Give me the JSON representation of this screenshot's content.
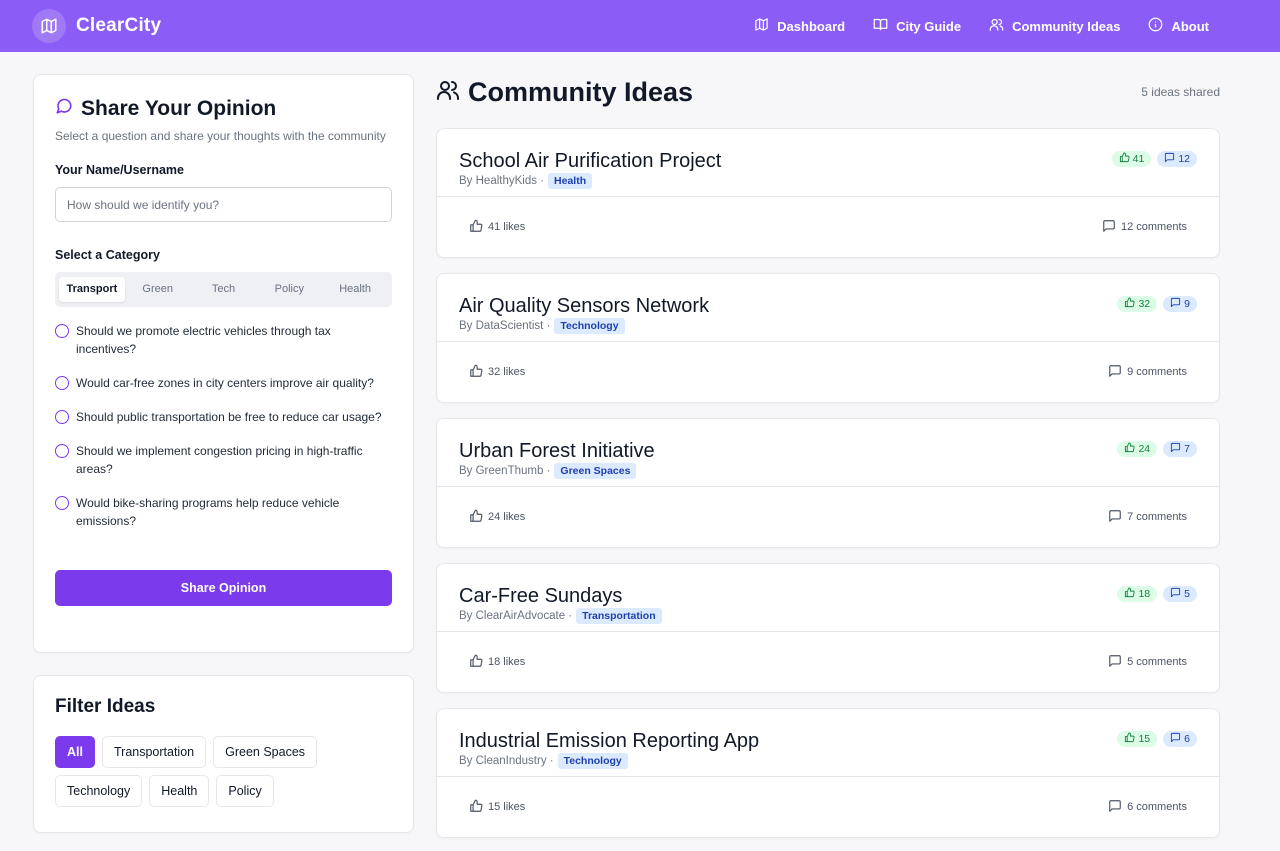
{
  "app": {
    "name": "ClearCity"
  },
  "nav": [
    {
      "label": "Dashboard",
      "icon": "map-icon"
    },
    {
      "label": "City Guide",
      "icon": "book-icon"
    },
    {
      "label": "Community Ideas",
      "icon": "users-icon"
    },
    {
      "label": "About",
      "icon": "info-icon"
    }
  ],
  "opinion": {
    "title": "Share Your Opinion",
    "subtitle": "Select a question and share your thoughts with the community",
    "name_label": "Your Name/Username",
    "name_placeholder": "How should we identify you?",
    "name_value": "",
    "category_label": "Select a Category",
    "tabs": [
      "Transport",
      "Green",
      "Tech",
      "Policy",
      "Health"
    ],
    "active_tab": "Transport",
    "questions": [
      "Should we promote electric vehicles through tax incentives?",
      "Would car-free zones in city centers improve air quality?",
      "Should public transportation be free to reduce car usage?",
      "Should we implement congestion pricing in high-traffic areas?",
      "Would bike-sharing programs help reduce vehicle emissions?"
    ],
    "submit_label": "Share Opinion"
  },
  "filter": {
    "title": "Filter Ideas",
    "chips": [
      "All",
      "Transportation",
      "Green Spaces",
      "Technology",
      "Health",
      "Policy"
    ],
    "active": "All"
  },
  "ideas": {
    "title": "Community Ideas",
    "count_text": "5 ideas shared",
    "items": [
      {
        "title": "School Air Purification Project",
        "author": "By HealthyKids ·",
        "tag": "Health",
        "likes_badge": "41",
        "comments_badge": "12",
        "likes_text": "41 likes",
        "comments_text": "12 comments"
      },
      {
        "title": "Air Quality Sensors Network",
        "author": "By DataScientist ·",
        "tag": "Technology",
        "likes_badge": "32",
        "comments_badge": "9",
        "likes_text": "32 likes",
        "comments_text": "9 comments"
      },
      {
        "title": "Urban Forest Initiative",
        "author": "By GreenThumb ·",
        "tag": "Green Spaces",
        "likes_badge": "24",
        "comments_badge": "7",
        "likes_text": "24 likes",
        "comments_text": "7 comments"
      },
      {
        "title": "Car-Free Sundays",
        "author": "By ClearAirAdvocate ·",
        "tag": "Transportation",
        "likes_badge": "18",
        "comments_badge": "5",
        "likes_text": "18 likes",
        "comments_text": "5 comments"
      },
      {
        "title": "Industrial Emission Reporting App",
        "author": "By CleanIndustry ·",
        "tag": "Technology",
        "likes_badge": "15",
        "comments_badge": "6",
        "likes_text": "15 likes",
        "comments_text": "6 comments"
      }
    ]
  },
  "colors": {
    "primary": "#8b5cf6",
    "accent": "#7c3aed",
    "like": "#15803d",
    "comment": "#1e40af"
  }
}
